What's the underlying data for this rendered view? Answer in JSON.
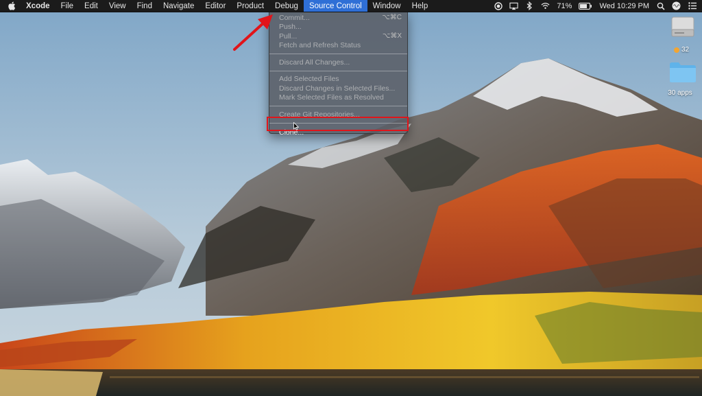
{
  "menubar": {
    "app_name": "Xcode",
    "items": [
      "File",
      "Edit",
      "View",
      "Find",
      "Navigate",
      "Editor",
      "Product",
      "Debug",
      "Source Control",
      "Window",
      "Help"
    ],
    "active_item": "Source Control",
    "status": {
      "battery": "71%",
      "clock": "Wed 10:29 PM"
    }
  },
  "source_control_menu": {
    "items": [
      {
        "label": "Commit...",
        "shortcut": "⌥⌘C",
        "enabled": false
      },
      {
        "label": "Push...",
        "shortcut": "",
        "enabled": false
      },
      {
        "label": "Pull...",
        "shortcut": "⌥⌘X",
        "enabled": false
      },
      {
        "label": "Fetch and Refresh Status",
        "shortcut": "",
        "enabled": false
      },
      {
        "label": "Discard All Changes...",
        "shortcut": "",
        "enabled": false
      },
      {
        "label": "Add Selected Files",
        "shortcut": "",
        "enabled": false
      },
      {
        "label": "Discard Changes in Selected Files...",
        "shortcut": "",
        "enabled": false
      },
      {
        "label": "Mark Selected Files as Resolved",
        "shortcut": "",
        "enabled": false
      },
      {
        "label": "Create Git Repositories...",
        "shortcut": "",
        "enabled": false
      },
      {
        "label": "Clone...",
        "shortcut": "",
        "enabled": true
      }
    ],
    "highlighted_item": "Clone..."
  },
  "desktop_icons": [
    {
      "name": "drive",
      "label": "32"
    },
    {
      "name": "folder",
      "label": "30 apps"
    }
  ],
  "colors": {
    "menubar_bg": "#1b1b1b",
    "menu_highlight": "#2f6fd6",
    "annotation_red": "#e1141a"
  }
}
